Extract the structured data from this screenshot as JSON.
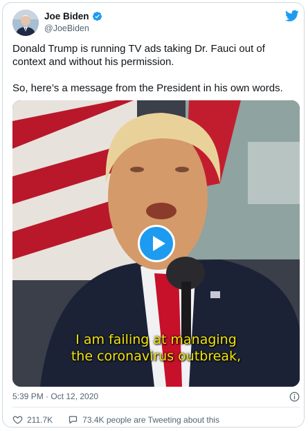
{
  "tweet": {
    "author": {
      "display_name": "Joe Biden",
      "handle": "@JoeBiden",
      "verified": true
    },
    "paragraphs": [
      "Donald Trump is running TV ads taking Dr. Fauci out of context and without his permission.",
      "So, here’s a message from the President in his own words."
    ],
    "media": {
      "type": "video",
      "caption_lines": [
        "I am failing at managing",
        "the coronavirus outbreak,"
      ]
    },
    "timestamp": "5:39 PM · Oct 12, 2020",
    "actions": {
      "likes": "211.7K",
      "tweeting_about": "73.4K people are Tweeting about this"
    }
  },
  "colors": {
    "accent": "#1d9bf0",
    "caption": "#f2e30a",
    "secondary_text": "#536471"
  },
  "icons": [
    "verified-badge-icon",
    "twitter-bird-icon",
    "play-icon",
    "info-icon",
    "heart-icon",
    "speech-bubble-icon"
  ]
}
